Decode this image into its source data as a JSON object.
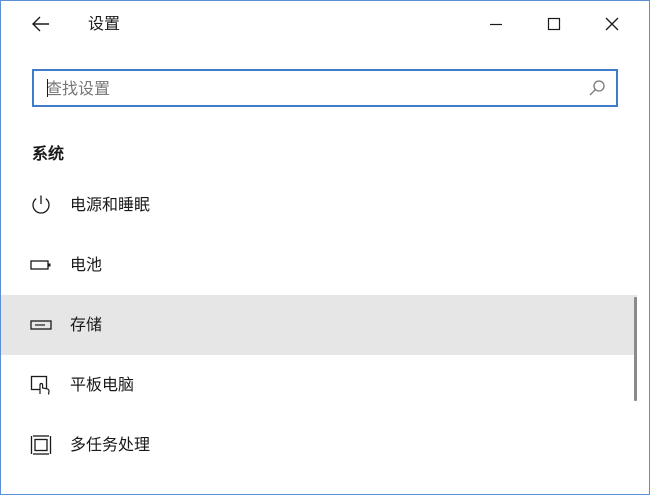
{
  "window": {
    "title": "设置",
    "controls": {
      "back_icon": "back-arrow-icon",
      "minimize_icon": "minimize-icon",
      "maximize_icon": "maximize-icon",
      "close_icon": "close-icon"
    }
  },
  "search": {
    "placeholder": "查找设置",
    "value": "",
    "icon": "search-icon"
  },
  "section": {
    "title": "系统"
  },
  "nav": {
    "items": [
      {
        "label": "电源和睡眠",
        "icon": "power-icon",
        "selected": false
      },
      {
        "label": "电池",
        "icon": "battery-icon",
        "selected": false
      },
      {
        "label": "存储",
        "icon": "storage-drive-icon",
        "selected": true
      },
      {
        "label": "平板电脑",
        "icon": "tablet-mode-icon",
        "selected": false
      },
      {
        "label": "多任务处理",
        "icon": "multitasking-icon",
        "selected": false
      }
    ]
  },
  "colors": {
    "accent": "#3f7cc9",
    "window_border": "#5b8fd6",
    "selected_bg": "#e6e6e6",
    "text": "#1a1a1a",
    "placeholder": "#777777"
  }
}
